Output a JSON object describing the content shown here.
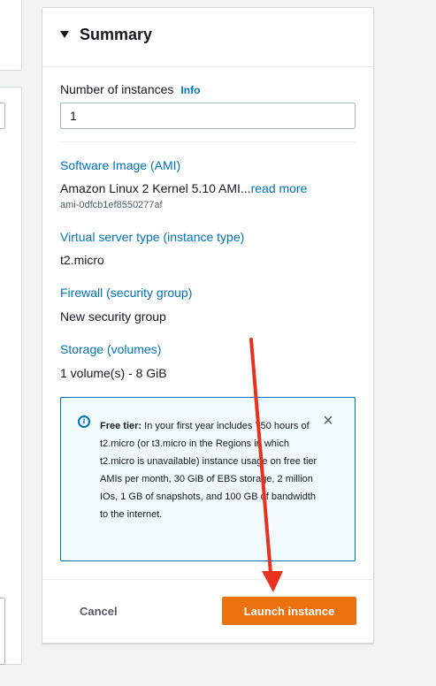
{
  "summary": {
    "title": "Summary",
    "num_instances_label": "Number of instances",
    "info_link": "Info",
    "num_instances_value": "1",
    "software_image": {
      "label": "Software Image (AMI)",
      "value": "Amazon Linux 2 Kernel 5.10 AMI...",
      "read_more": "read more",
      "ami_id": "ami-0dfcb1ef8550277af"
    },
    "instance_type": {
      "label": "Virtual server type (instance type)",
      "value": "t2.micro"
    },
    "firewall": {
      "label": "Firewall (security group)",
      "value": "New security group"
    },
    "storage": {
      "label": "Storage (volumes)",
      "value": "1 volume(s) - 8 GiB"
    },
    "free_tier_alert": {
      "title": "Free tier:",
      "body": " In your first year includes 750 hours of t2.micro (or t3.micro in the Regions in which t2.micro is unavailable) instance usage on free tier AMIs per month, 30 GiB of EBS storage, 2 million IOs, 1 GB of snapshots, and 100 GB of bandwidth to the internet.",
      "close_icon": "×"
    },
    "footer": {
      "cancel_label": "Cancel",
      "launch_label": "Launch instance"
    }
  },
  "colors": {
    "accent_orange": "#ec7211",
    "link_blue": "#0073bb",
    "annotation_red": "#e8321e"
  }
}
